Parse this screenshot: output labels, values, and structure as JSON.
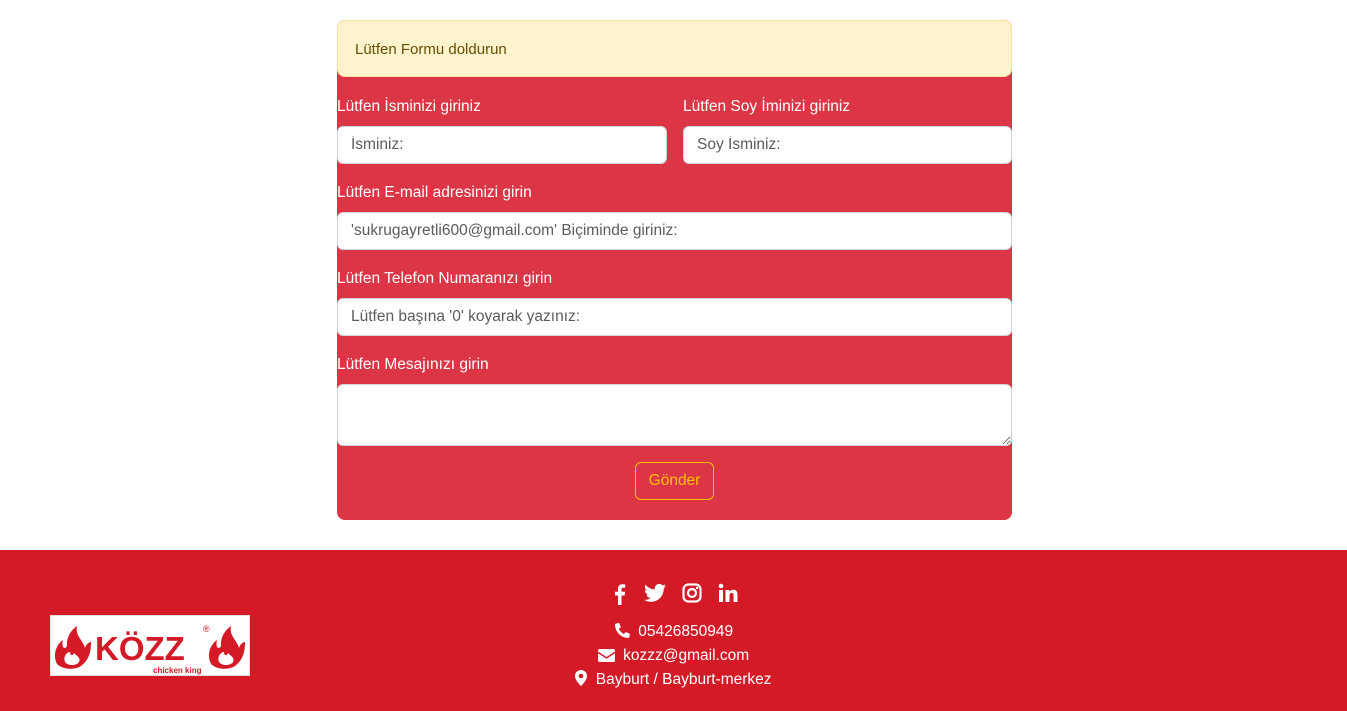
{
  "form": {
    "alert_text": "Lütfen Formu doldurun",
    "first_name": {
      "label": "Lütfen İsminizi giriniz",
      "placeholder": "İsminiz:"
    },
    "last_name": {
      "label": "Lütfen Soy İminizi giriniz",
      "placeholder": "Soy İsminiz:"
    },
    "email": {
      "label": "Lütfen E-mail adresinizi girin",
      "placeholder": "'sukrugayretli600@gmail.com' Biçiminde giriniz:"
    },
    "phone": {
      "label": "Lütfen Telefon Numaranızı girin",
      "placeholder": "Lütfen başına '0' koyarak yazınız:"
    },
    "message": {
      "label": "Lütfen Mesajınızı girin",
      "value": ""
    },
    "submit_label": "Gönder"
  },
  "footer": {
    "logo": {
      "brand": "KÖZZ",
      "tagline": "chicken king",
      "mark": "®"
    },
    "social_icons": [
      "facebook-icon",
      "twitter-icon",
      "instagram-icon",
      "linkedin-icon"
    ],
    "phone": "05426850949",
    "email": "kozzz@gmail.com",
    "address": "Bayburt / Bayburt-merkez"
  },
  "colors": {
    "form_background": "#dc3545",
    "alert_background": "#fff3cd",
    "alert_text": "#664d03",
    "button_outline": "#ffc107",
    "footer_background": "#d41a26",
    "logo_red": "#d41a26"
  }
}
